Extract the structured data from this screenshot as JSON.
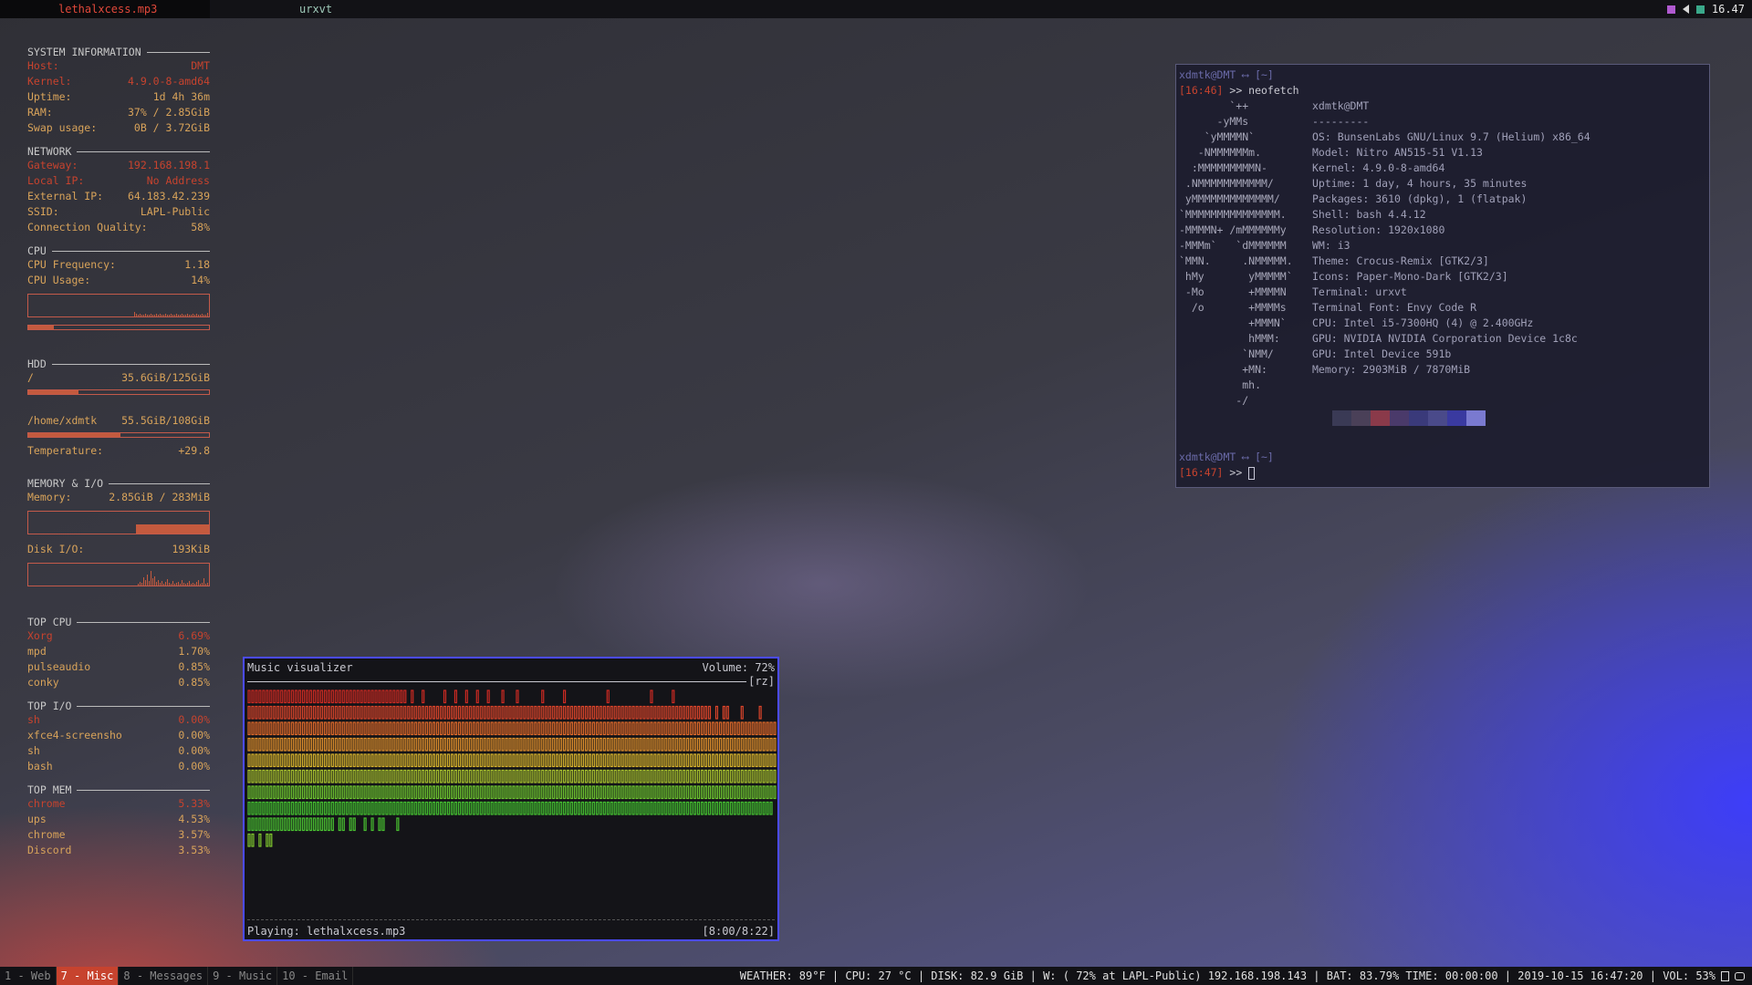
{
  "topbar": {
    "title": "lethalxcess.mp3",
    "window": "urxvt",
    "clock": "16.47",
    "tray_icons": [
      {
        "name": "discord-tray-icon",
        "color": "#b05ad0"
      },
      {
        "name": "volume-tray-icon",
        "color": "#d8d8d8"
      },
      {
        "name": "battery-tray-icon",
        "color": "#3aa88a"
      }
    ]
  },
  "conky": {
    "system": {
      "header": "SYSTEM INFORMATION",
      "rows": [
        {
          "label": "Host:",
          "value": "DMT",
          "color": "red"
        },
        {
          "label": "Kernel:",
          "value": "4.9.0-8-amd64",
          "color": "red"
        },
        {
          "label": "Uptime:",
          "value": "1d 4h 36m",
          "color": "orange"
        },
        {
          "label": "RAM:",
          "value": "37% / 2.85GiB",
          "color": "orange"
        },
        {
          "label": "Swap usage:",
          "value": "0B  / 3.72GiB",
          "color": "orange"
        }
      ]
    },
    "network": {
      "header": "NETWORK",
      "rows": [
        {
          "label": "Gateway:",
          "value": "192.168.198.1",
          "color": "red"
        },
        {
          "label": "Local IP:",
          "value": "No Address",
          "color": "red"
        },
        {
          "label": "External IP:",
          "value": "64.183.42.239",
          "color": "orange"
        },
        {
          "label": "SSID:",
          "value": "LAPL-Public",
          "color": "orange"
        },
        {
          "label": "Connection Quality:",
          "value": "58%",
          "color": "orange"
        }
      ]
    },
    "cpu": {
      "header": "CPU",
      "rows": [
        {
          "label": "CPU Frequency:",
          "value": "1.18",
          "color": "orange"
        },
        {
          "label": "CPU Usage:",
          "value": "14%",
          "color": "orange"
        }
      ],
      "usage_fraction": 0.14
    },
    "hdd": {
      "header": "HDD",
      "root": {
        "label": "/",
        "value": "35.6GiB/125GiB",
        "fraction": 0.28
      },
      "home": {
        "label": "/home/xdmtk",
        "value": "55.5GiB/108GiB",
        "fraction": 0.51
      },
      "temp": {
        "label": "Temperature:",
        "value": "+29.8"
      }
    },
    "memio": {
      "header": "MEMORY & I/O",
      "memory": {
        "label": "Memory:",
        "value": "2.85GiB / 283MiB"
      },
      "disk": {
        "label": "Disk I/O:",
        "value": "193KiB"
      }
    },
    "top_cpu": {
      "header": "TOP CPU",
      "rows": [
        {
          "label": "Xorg",
          "value": "6.69%",
          "color": "red"
        },
        {
          "label": "mpd",
          "value": "1.70%",
          "color": "orange"
        },
        {
          "label": "pulseaudio",
          "value": "0.85%",
          "color": "orange"
        },
        {
          "label": "conky",
          "value": "0.85%",
          "color": "orange"
        }
      ]
    },
    "top_io": {
      "header": "TOP I/O",
      "rows": [
        {
          "label": "sh",
          "value": "0.00%",
          "color": "red"
        },
        {
          "label": "xfce4-screensho",
          "value": "0.00%",
          "color": "orange"
        },
        {
          "label": "sh",
          "value": "0.00%",
          "color": "orange"
        },
        {
          "label": "bash",
          "value": "0.00%",
          "color": "orange"
        }
      ]
    },
    "top_mem": {
      "header": "TOP MEM",
      "rows": [
        {
          "label": "chrome",
          "value": "5.33%",
          "color": "red"
        },
        {
          "label": "ups",
          "value": "4.53%",
          "color": "orange"
        },
        {
          "label": "chrome",
          "value": "3.57%",
          "color": "orange"
        },
        {
          "label": "Discord",
          "value": "3.53%",
          "color": "orange"
        }
      ]
    }
  },
  "terminal": {
    "prompt1_user": "xdmtk@DMT ⟷ [~]",
    "prompt1_time": "[16:46]",
    "prompt1_cmd": " >> neofetch",
    "ascii": [
      "        `++",
      "      -yMMs",
      "    `yMMMMN`",
      "   -NMMMMMMm.",
      "  :MMMMMMMMMN-",
      " .NMMMMMMMMMMM/",
      " yMMMMMMMMMMMMM/",
      "`MMMMMMMMMMMMMMM.",
      "-MMMMN+ /mMMMMMMy",
      "-MMMm`   `dMMMMMM",
      "`MMN.     .NMMMMM.",
      " hMy       yMMMMM`",
      " -Mo       +MMMMN",
      "  /o       +MMMMs",
      "           +MMMN`",
      "           hMMM:",
      "          `NMM/",
      "          +MN:",
      "          mh.",
      "         -/"
    ],
    "info": [
      "xdmtk@DMT",
      "---------",
      "OS: BunsenLabs GNU/Linux 9.7 (Helium) x86_64",
      "Model: Nitro AN515-51 V1.13",
      "Kernel: 4.9.0-8-amd64",
      "Uptime: 1 day, 4 hours, 35 minutes",
      "Packages: 3610 (dpkg), 1 (flatpak)",
      "Shell: bash 4.4.12",
      "Resolution: 1920x1080",
      "WM: i3",
      "Theme: Crocus-Remix [GTK2/3]",
      "Icons: Paper-Mono-Dark [GTK2/3]",
      "Terminal: urxvt",
      "Terminal Font: Envy Code R",
      "CPU: Intel i5-7300HQ (4) @ 2.400GHz",
      "GPU: NVIDIA NVIDIA Corporation Device 1c8c",
      "GPU: Intel Device 591b",
      "Memory: 2903MiB / 7870MiB"
    ],
    "swatches": [
      "#3a3a55",
      "#4a4058",
      "#8a3a4a",
      "#4a3a6a",
      "#3a3a7a",
      "#4a4a8a",
      "#3a3aa0",
      "#7a7ad0"
    ],
    "prompt2_user": "xdmtk@DMT ⟷ [~]",
    "prompt2_time": "[16:47]",
    "prompt2_cmd": " >> "
  },
  "visualizer": {
    "title": "Music visualizer",
    "volume": "Volume: 72%",
    "tag": "[rz]",
    "playing": "Playing: lethalxcess.mp3",
    "time": "[8:00/8:22]",
    "bar_heights": [
      12,
      13,
      10,
      12,
      11,
      13,
      12,
      11,
      10,
      10,
      10,
      10,
      11,
      10,
      9,
      9,
      9,
      10,
      9,
      10,
      9,
      11,
      9,
      9,
      8,
      9,
      9,
      8,
      9,
      9,
      8,
      8,
      9,
      8,
      9,
      8,
      9,
      9,
      8,
      8,
      8,
      9,
      8,
      8,
      7,
      8,
      7,
      7,
      8,
      7,
      7,
      7,
      7,
      7,
      8,
      7,
      7,
      8,
      7,
      7,
      8,
      7,
      7,
      8,
      7,
      7,
      8,
      7,
      7,
      7,
      8,
      7,
      7,
      7,
      8,
      7,
      7,
      7,
      7,
      7,
      7,
      8,
      7,
      7,
      7,
      7,
      7,
      8,
      7,
      7,
      7,
      7,
      7,
      7,
      7,
      7,
      7,
      7,
      7,
      8,
      7,
      7,
      7,
      7,
      7,
      7,
      7,
      7,
      7,
      7,
      7,
      8,
      7,
      7,
      7,
      7,
      7,
      8,
      7,
      7,
      7,
      7,
      7,
      7,
      7,
      7,
      7,
      7,
      6,
      7,
      6,
      7,
      7,
      6,
      6,
      6,
      7,
      6,
      6,
      6,
      6,
      7,
      6,
      6,
      6,
      5
    ]
  },
  "bottombar": {
    "workspaces": [
      {
        "label": "1 - Web",
        "active": false
      },
      {
        "label": "7 - Misc",
        "active": true
      },
      {
        "label": "8 - Messages",
        "active": false
      },
      {
        "label": "9 - Music",
        "active": false
      },
      {
        "label": "10 - Email",
        "active": false
      }
    ],
    "status": "WEATHER: 89°F | CPU: 27 °C | DISK: 82.9 GiB | W: ( 72% at LAPL-Public) 192.168.198.143 | BAT: 83.79% TIME: 00:00:00 | 2019-10-15 16:47:20 | VOL: 53%"
  },
  "colors": {
    "accent_red": "#c7432e",
    "accent_orange": "#d8a35a",
    "viz_border": "#4b4bff"
  }
}
